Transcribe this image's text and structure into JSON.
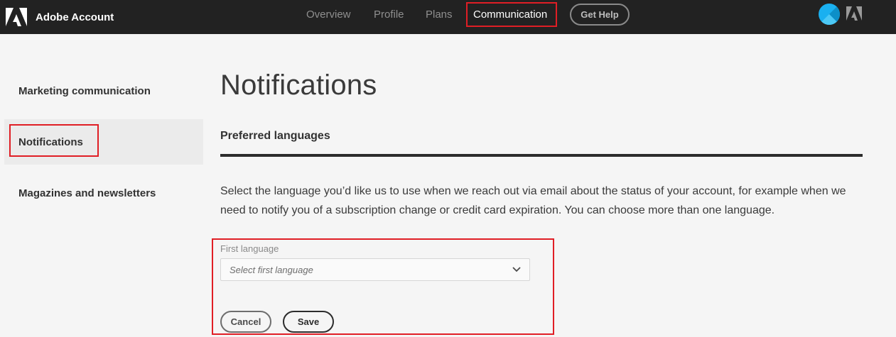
{
  "header": {
    "app_name": "Adobe Account",
    "nav": [
      {
        "label": "Overview",
        "active": false
      },
      {
        "label": "Profile",
        "active": false
      },
      {
        "label": "Plans",
        "active": false
      },
      {
        "label": "Communication",
        "active": true
      }
    ],
    "get_help_label": "Get Help",
    "icons": [
      "adobe-logo-icon",
      "avatar",
      "adobe-small-icon"
    ]
  },
  "sidebar": {
    "items": [
      {
        "label": "Marketing communication",
        "selected": false
      },
      {
        "label": "Notifications",
        "selected": true
      },
      {
        "label": "Magazines and newsletters",
        "selected": false
      }
    ]
  },
  "main": {
    "title": "Notifications",
    "section_title": "Preferred languages",
    "description": "Select the language you’d like us to use when we reach out via email about the status of your account, for example when we need to notify you of a subscription change or credit card expiration. You can choose more than one language.",
    "form": {
      "first_language_label": "First language",
      "first_language_placeholder": "Select first language",
      "cancel_label": "Cancel",
      "save_label": "Save"
    }
  },
  "colors": {
    "topbar": "#222222",
    "highlight": "#e01e25",
    "avatar": "#1ab0f0",
    "background": "#f5f5f5"
  }
}
